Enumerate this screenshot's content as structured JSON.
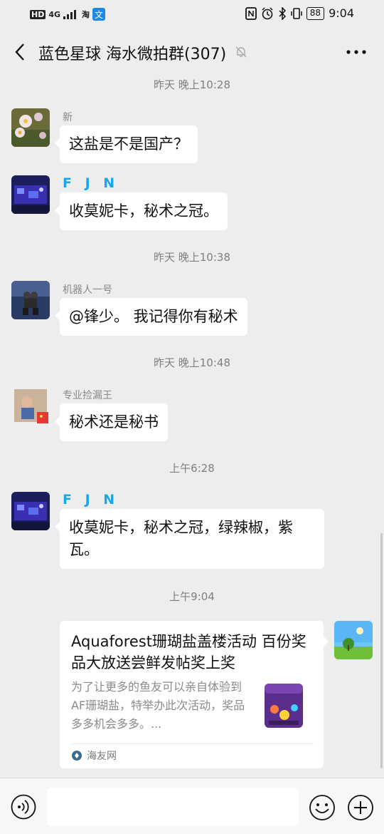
{
  "status": {
    "hd": "HD",
    "net": "4G",
    "carrier": "淘",
    "battery": "88",
    "time": "9:04"
  },
  "header": {
    "title": "蓝色星球 海水微拍群(307)"
  },
  "icons": {
    "back": "chevron-left-icon",
    "mute": "bell-off-icon",
    "more": "more-dots-icon",
    "voice": "voice-icon",
    "emoji": "emoji-icon",
    "plus": "plus-icon"
  },
  "messages": [
    {
      "time": "昨天 晚上10:28"
    },
    {
      "sender": "新",
      "text": "这盐是不是国产？"
    },
    {
      "sender": "F J N",
      "text": "收莫妮卡，秘术之冠。"
    },
    {
      "time": "昨天 晚上10:38"
    },
    {
      "sender": "机器人一号",
      "text": "@锋少。 我记得你有秘术"
    },
    {
      "time": "昨天 晚上10:48"
    },
    {
      "sender": "专业捡漏王",
      "text": "秘术还是秘书"
    },
    {
      "time": "上午6:28"
    },
    {
      "sender": "F J N",
      "text": "收莫妮卡，秘术之冠，绿辣椒，紫瓦。"
    },
    {
      "time": "上午9:04"
    }
  ],
  "link_card": {
    "title": "Aquaforest珊瑚盐盖楼活动 百份奖品大放送尝鲜发帖奖上奖",
    "desc": "为了让更多的鱼友可以亲自体验到AF珊瑚盐，特举办此次活动，奖品多多机会多多。...",
    "source": "海友网"
  },
  "colors": {
    "bg": "#ededed",
    "bubble": "#ffffff",
    "nick_highlight": "#1aa7e6",
    "timestamp": "#7f7f7f"
  }
}
